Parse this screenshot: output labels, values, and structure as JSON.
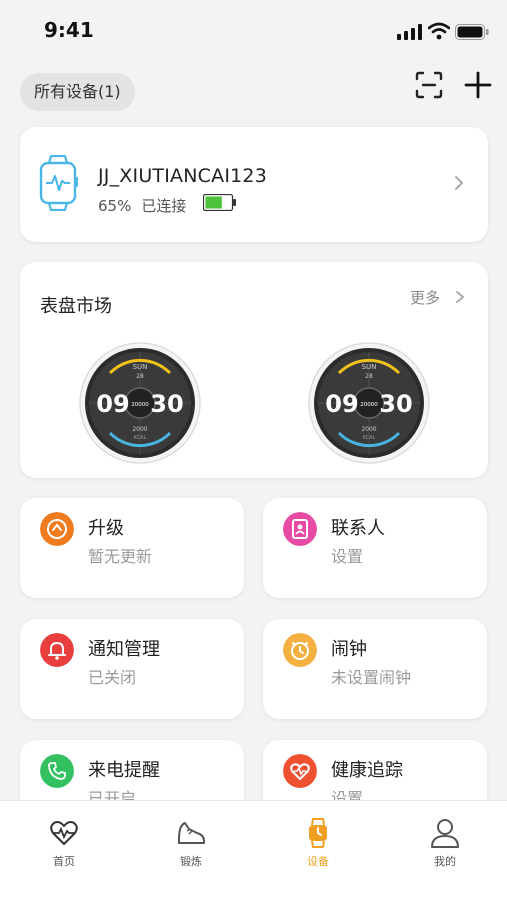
{
  "status_bar": {
    "time": "9:41"
  },
  "header": {
    "device_chip": "所有设备(1)"
  },
  "device_card": {
    "name": "JJ_XIUTIANCAI123",
    "battery_percent": "65%",
    "connection": "已连接",
    "battery_level": 0.65
  },
  "watch_market": {
    "title": "表盘市场",
    "more_label": "更多",
    "faces": [
      {
        "day": "SUN",
        "date": "28",
        "hour": "09",
        "minute": "30",
        "steps": "20000",
        "kcal": "2000",
        "kcal_unit": "KCAL"
      },
      {
        "day": "SUN",
        "date": "28",
        "hour": "09",
        "minute": "30",
        "steps": "20000",
        "kcal": "2000",
        "kcal_unit": "KCAL"
      }
    ]
  },
  "tiles": [
    {
      "title": "升级",
      "subtitle": "暂无更新",
      "icon": "upgrade-icon",
      "color": "#f07a1e"
    },
    {
      "title": "联系人",
      "subtitle": "设置",
      "icon": "contacts-icon",
      "color": "#e64aa3"
    },
    {
      "title": "通知管理",
      "subtitle": "已关闭",
      "icon": "bell-icon",
      "color": "#e83e3e"
    },
    {
      "title": "闹钟",
      "subtitle": "未设置闹钟",
      "icon": "alarm-icon",
      "color": "#f4b040"
    },
    {
      "title": "来电提醒",
      "subtitle": "已开启",
      "icon": "phone-icon",
      "color": "#33c060"
    },
    {
      "title": "健康追踪",
      "subtitle": "设置",
      "icon": "health-icon",
      "color": "#ee5030"
    }
  ],
  "tabbar": [
    {
      "label": "首页",
      "icon": "heart-pulse-icon",
      "active": false
    },
    {
      "label": "锻炼",
      "icon": "shoe-icon",
      "active": false
    },
    {
      "label": "设备",
      "icon": "watch-icon",
      "active": true
    },
    {
      "label": "我的",
      "icon": "person-icon",
      "active": false
    }
  ],
  "colors": {
    "accent": "#f0a020",
    "battery_green": "#4cc13a",
    "watch_blue": "#4ab6e8"
  }
}
